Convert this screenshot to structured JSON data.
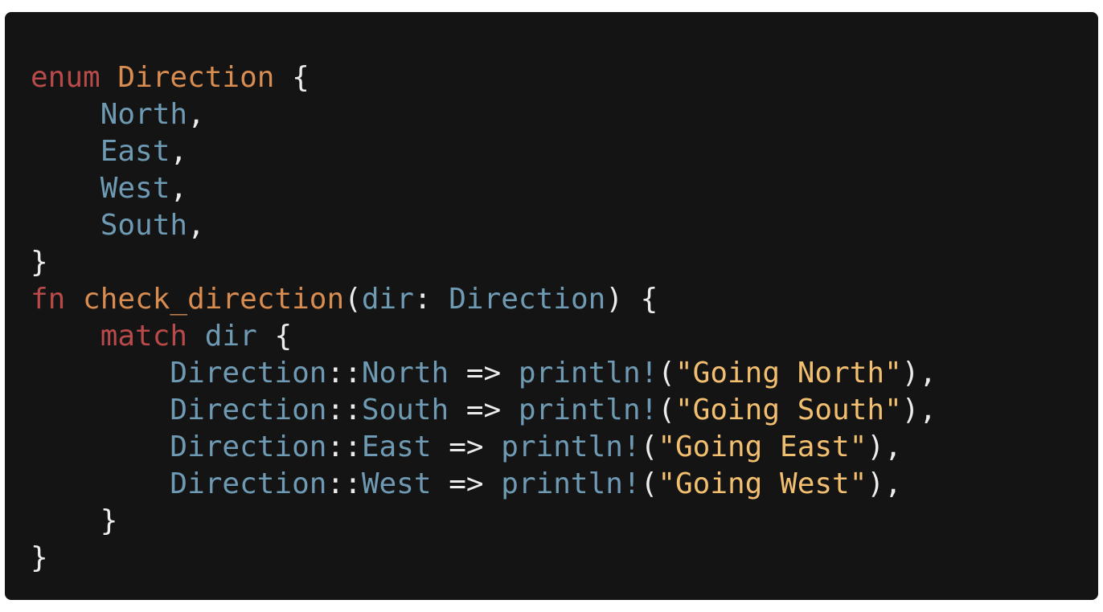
{
  "editor": {
    "background": "#141414",
    "colors": {
      "keyword": "#b84a4a",
      "type": "#d98c50",
      "function": "#d98c50",
      "identifier": "#6f9ab3",
      "punct": "#ececec",
      "string": "#f2bf70"
    },
    "lines": [
      {
        "tokens": [
          {
            "t": "enum",
            "c": "keyword"
          },
          {
            "t": " ",
            "c": "punct"
          },
          {
            "t": "Direction",
            "c": "type"
          },
          {
            "t": " {",
            "c": "punct"
          }
        ]
      },
      {
        "tokens": [
          {
            "t": "    ",
            "c": "punct"
          },
          {
            "t": "North",
            "c": "identifier"
          },
          {
            "t": ",",
            "c": "punct"
          }
        ]
      },
      {
        "tokens": [
          {
            "t": "    ",
            "c": "punct"
          },
          {
            "t": "East",
            "c": "identifier"
          },
          {
            "t": ",",
            "c": "punct"
          }
        ]
      },
      {
        "tokens": [
          {
            "t": "    ",
            "c": "punct"
          },
          {
            "t": "West",
            "c": "identifier"
          },
          {
            "t": ",",
            "c": "punct"
          }
        ]
      },
      {
        "tokens": [
          {
            "t": "    ",
            "c": "punct"
          },
          {
            "t": "South",
            "c": "identifier"
          },
          {
            "t": ",",
            "c": "punct"
          }
        ]
      },
      {
        "tokens": [
          {
            "t": "}",
            "c": "punct"
          }
        ]
      },
      {
        "tokens": [
          {
            "t": "fn",
            "c": "keyword"
          },
          {
            "t": " ",
            "c": "punct"
          },
          {
            "t": "check_direction",
            "c": "function"
          },
          {
            "t": "(",
            "c": "punct"
          },
          {
            "t": "dir",
            "c": "identifier"
          },
          {
            "t": ": ",
            "c": "punct"
          },
          {
            "t": "Direction",
            "c": "identifier"
          },
          {
            "t": ") {",
            "c": "punct"
          }
        ]
      },
      {
        "tokens": [
          {
            "t": "    ",
            "c": "punct"
          },
          {
            "t": "match",
            "c": "keyword"
          },
          {
            "t": " ",
            "c": "punct"
          },
          {
            "t": "dir",
            "c": "identifier"
          },
          {
            "t": " {",
            "c": "punct"
          }
        ]
      },
      {
        "tokens": [
          {
            "t": "        ",
            "c": "punct"
          },
          {
            "t": "Direction",
            "c": "identifier"
          },
          {
            "t": "::",
            "c": "punct"
          },
          {
            "t": "North",
            "c": "identifier"
          },
          {
            "t": " => ",
            "c": "punct"
          },
          {
            "t": "println!",
            "c": "identifier"
          },
          {
            "t": "(",
            "c": "punct"
          },
          {
            "t": "\"Going North\"",
            "c": "string"
          },
          {
            "t": "),",
            "c": "punct"
          }
        ]
      },
      {
        "tokens": [
          {
            "t": "        ",
            "c": "punct"
          },
          {
            "t": "Direction",
            "c": "identifier"
          },
          {
            "t": "::",
            "c": "punct"
          },
          {
            "t": "South",
            "c": "identifier"
          },
          {
            "t": " => ",
            "c": "punct"
          },
          {
            "t": "println!",
            "c": "identifier"
          },
          {
            "t": "(",
            "c": "punct"
          },
          {
            "t": "\"Going South\"",
            "c": "string"
          },
          {
            "t": "),",
            "c": "punct"
          }
        ]
      },
      {
        "tokens": [
          {
            "t": "        ",
            "c": "punct"
          },
          {
            "t": "Direction",
            "c": "identifier"
          },
          {
            "t": "::",
            "c": "punct"
          },
          {
            "t": "East",
            "c": "identifier"
          },
          {
            "t": " => ",
            "c": "punct"
          },
          {
            "t": "println!",
            "c": "identifier"
          },
          {
            "t": "(",
            "c": "punct"
          },
          {
            "t": "\"Going East\"",
            "c": "string"
          },
          {
            "t": "),",
            "c": "punct"
          }
        ]
      },
      {
        "tokens": [
          {
            "t": "        ",
            "c": "punct"
          },
          {
            "t": "Direction",
            "c": "identifier"
          },
          {
            "t": "::",
            "c": "punct"
          },
          {
            "t": "West",
            "c": "identifier"
          },
          {
            "t": " => ",
            "c": "punct"
          },
          {
            "t": "println!",
            "c": "identifier"
          },
          {
            "t": "(",
            "c": "punct"
          },
          {
            "t": "\"Going West\"",
            "c": "string"
          },
          {
            "t": "),",
            "c": "punct"
          }
        ]
      },
      {
        "tokens": [
          {
            "t": "    ",
            "c": "punct"
          },
          {
            "t": "}",
            "c": "punct"
          }
        ]
      },
      {
        "tokens": [
          {
            "t": "}",
            "c": "punct"
          }
        ]
      }
    ]
  }
}
